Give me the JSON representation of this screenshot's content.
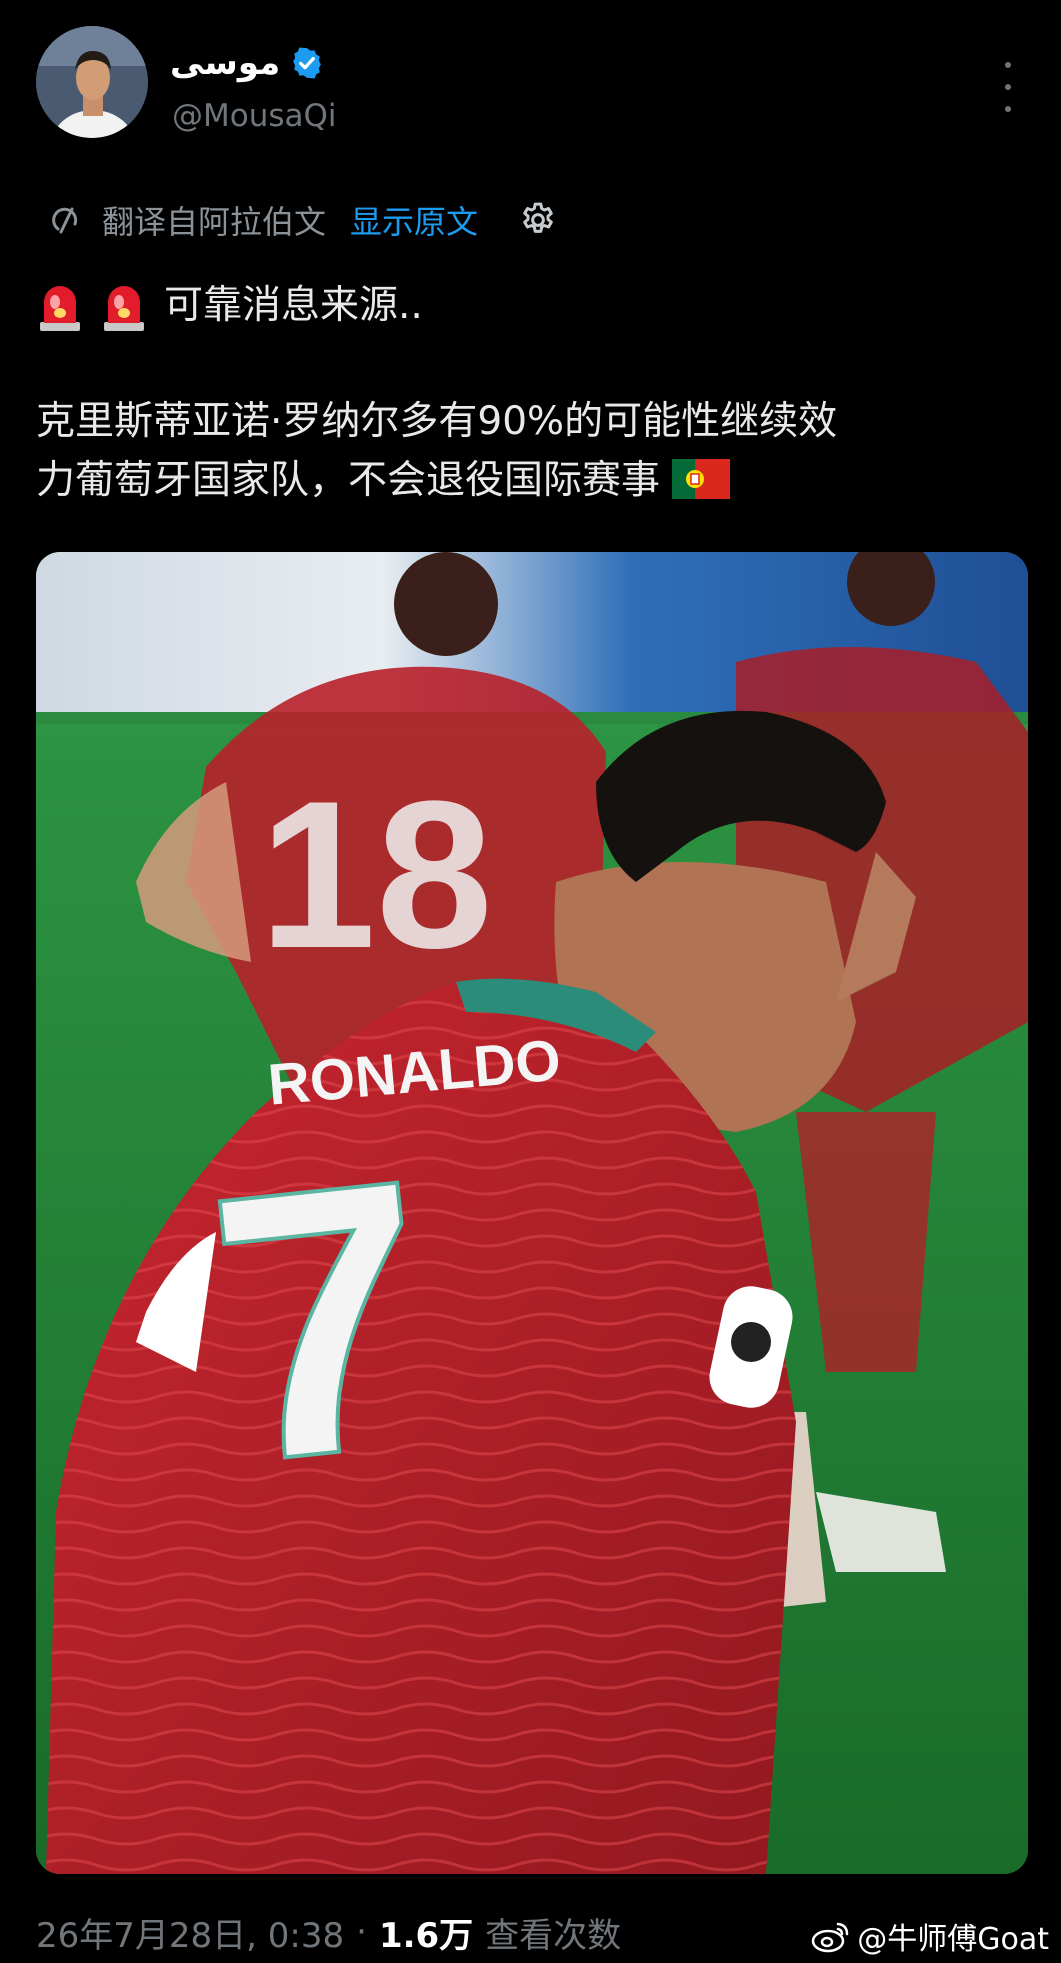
{
  "header": {
    "display_name": "موسى",
    "handle": "@MousaQi",
    "verified": true,
    "more_icon": "more-vertical-icon"
  },
  "translation_bar": {
    "label": "翻译自阿拉伯文",
    "show_original": "显示原文",
    "settings_icon": "gear-icon"
  },
  "tweet": {
    "line1_text": "可靠消息来源..",
    "line1_icons": [
      "siren-emoji",
      "siren-emoji"
    ],
    "paragraph2": "克里斯蒂亚诺·罗纳尔多有90%的可能性继续效\n力葡萄牙国家队，不会退役国际赛事",
    "trailing_icon": "portugal-flag-emoji"
  },
  "media": {
    "jersey_name": "RONALDO",
    "jersey_number": "7",
    "background_number": "18"
  },
  "meta": {
    "timestamp": "26年7月28日, 0:38",
    "separator": "·",
    "views_count": "1.6万",
    "views_label": "查看次数"
  },
  "watermark": {
    "text": "@牛师傅Goat",
    "icon": "weibo-logo"
  },
  "colors": {
    "background": "#000000",
    "text_primary": "#e7e9ea",
    "text_secondary": "#71767b",
    "link": "#1d9bf0",
    "verified": "#1d9bf0",
    "jersey_red": "#b8202a"
  }
}
